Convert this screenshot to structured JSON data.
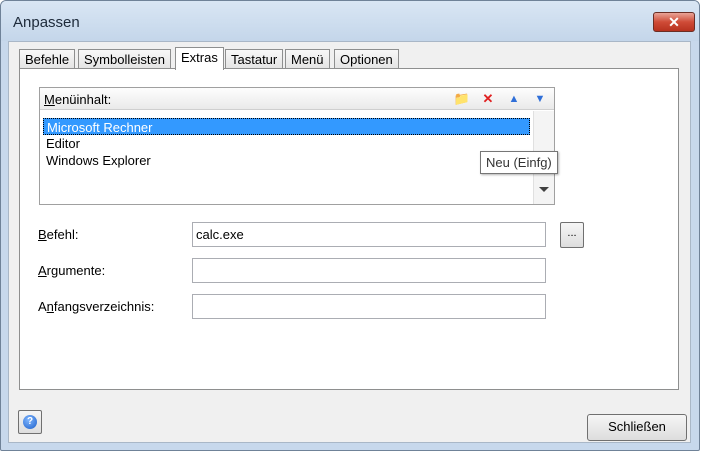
{
  "window": {
    "title": "Anpassen",
    "close_glyph": "✕"
  },
  "tabs": [
    {
      "label": "Befehle"
    },
    {
      "label": "Symbolleisten"
    },
    {
      "label": "Extras",
      "active": true
    },
    {
      "label": "Tastatur"
    },
    {
      "label": "Menü"
    },
    {
      "label": "Optionen"
    }
  ],
  "menu_content": {
    "label_ul": "M",
    "label_rest": "enüinhalt:",
    "toolbar": [
      {
        "icon": "new-folder-icon",
        "glyph": "📁"
      },
      {
        "icon": "delete-icon",
        "glyph": "✕",
        "color": "#e02020"
      },
      {
        "icon": "move-up-icon",
        "glyph": "▲",
        "color": "#2f6fd8"
      },
      {
        "icon": "move-down-icon",
        "glyph": "▼",
        "color": "#2f6fd8"
      }
    ],
    "items": [
      "Microsoft Rechner",
      "Editor",
      "Windows Explorer"
    ],
    "selected_index": 0,
    "tooltip": "Neu (Einfg)"
  },
  "fields": {
    "befehl": {
      "label_ul": "B",
      "label_rest": "efehl:",
      "value": "calc.exe"
    },
    "argumente": {
      "label_ul": "A",
      "label_rest": "rgumente:",
      "value": ""
    },
    "anfangsverzeichnis": {
      "label_pre": "A",
      "label_ul": "n",
      "label_rest": "fangsverzeichnis:",
      "value": ""
    }
  },
  "browse_button": {
    "label": "..."
  },
  "help_button": {
    "glyph": "?"
  },
  "close_button": {
    "label": "Schließen"
  },
  "colors": {
    "selection": "#3399ff",
    "window_frame": "#c7d8ec"
  }
}
